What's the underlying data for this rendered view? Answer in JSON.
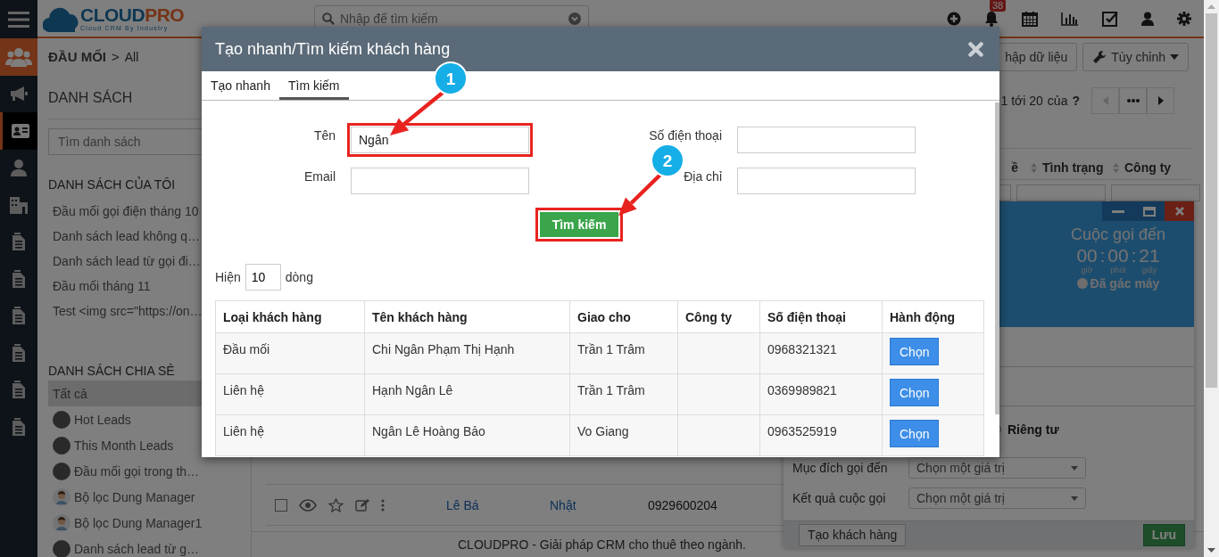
{
  "top_bar": {
    "logo": {
      "part_1": "CLOUD",
      "part_2": "PRO",
      "tagline": "Cloud CRM By Industry"
    },
    "search": {
      "placeholder": "Nhập để tìm kiếm"
    },
    "notifications": {
      "count": "38"
    }
  },
  "rail": [
    {
      "kind": "menu",
      "selected": false
    },
    {
      "kind": "people",
      "selected": false
    },
    {
      "kind": "megaphone",
      "selected": false
    },
    {
      "kind": "card",
      "selected": true
    },
    {
      "kind": "person",
      "selected": false
    },
    {
      "kind": "building",
      "selected": false
    },
    {
      "kind": "document",
      "selected": false
    },
    {
      "kind": "document",
      "selected": false
    },
    {
      "kind": "document",
      "selected": false
    },
    {
      "kind": "document",
      "selected": false
    },
    {
      "kind": "document",
      "selected": false
    },
    {
      "kind": "document",
      "selected": false
    }
  ],
  "breadcrumb": {
    "module": "ĐẦU MỐI",
    "separator": ">",
    "current": "All"
  },
  "sidebar": {
    "title": "DANH SÁCH",
    "search": {
      "placeholder": "Tìm danh sách"
    },
    "groups": [
      {
        "title": "DANH SÁCH CỦA TÔI",
        "items": [
          {
            "label": "Đầu mối gọi điện tháng 10",
            "selected": false,
            "kind": "plain"
          },
          {
            "label": "Danh sách lead không q…",
            "selected": false,
            "kind": "plain"
          },
          {
            "label": "Danh sách lead từ gọi đi…",
            "selected": false,
            "kind": "plain"
          },
          {
            "label": "Đầu mối tháng 11",
            "selected": false,
            "kind": "plain"
          },
          {
            "label": "Test <img src=\"https://on…",
            "selected": false,
            "kind": "plain"
          }
        ]
      },
      {
        "title": "DANH SÁCH CHIA SẺ",
        "items": [
          {
            "label": "Tất cả",
            "selected": true,
            "kind": "plain"
          },
          {
            "label": "Hot Leads",
            "selected": false,
            "kind": "photo"
          },
          {
            "label": "This Month Leads",
            "selected": false,
            "kind": "photo"
          },
          {
            "label": "Đầu mối gọi trong th…",
            "selected": false,
            "kind": "photo"
          },
          {
            "label": "Bộ lọc Dung Manager",
            "selected": false,
            "kind": "cartoon"
          },
          {
            "label": "Bộ lọc Dung Manager1",
            "selected": false,
            "kind": "cartoon"
          },
          {
            "label": "Danh sách lead từ g…",
            "selected": false,
            "kind": "photo"
          }
        ]
      }
    ]
  },
  "toolbar": {
    "buttons": [
      {
        "label": "hập dữ liệu",
        "kind": "plain"
      },
      {
        "label": "Tùy chỉnh",
        "kind": "dropdown"
      }
    ]
  },
  "pagination": {
    "range": "1 tới 20",
    "of": "của",
    "total": "?"
  },
  "list": {
    "columns": [
      "ề",
      "Tình trạng",
      "Công ty"
    ],
    "rows": [
      {
        "checked": false,
        "name": "Lê Bá",
        "assignee": "Nhật",
        "phone": "0929600204"
      }
    ]
  },
  "footer": "CLOUDPRO - Giải pháp CRM cho thuê theo ngành.",
  "call_widget": {
    "title": "Cuộc gọi đến",
    "timer": [
      {
        "value": "00",
        "unit": "giờ"
      },
      {
        "value": "00",
        "unit": "phút"
      },
      {
        "value": "21",
        "unit": "giây"
      }
    ],
    "separators": [
      ":",
      ":"
    ],
    "status": "Đã gác máy",
    "privacy": {
      "label": "Riêng tư",
      "selected": false
    },
    "fields": [
      {
        "label": "Mục đích gọi đến",
        "placeholder": "Chọn một giá trị"
      },
      {
        "label": "Kết quả cuộc gọi",
        "placeholder": "Chọn một giá trị"
      }
    ],
    "buttons": [
      {
        "label": "Tạo khách hàng",
        "kind": "default"
      },
      {
        "label": "Lưu",
        "kind": "primary"
      }
    ]
  },
  "modal": {
    "title": "Tạo nhanh/Tìm kiếm khách hàng",
    "tabs": [
      {
        "label": "Tạo nhanh",
        "selected": false
      },
      {
        "label": "Tìm kiếm",
        "selected": true
      }
    ],
    "fields": [
      {
        "label": "Tên",
        "value": "Ngân",
        "highlighted": true
      },
      {
        "label": "Số điện thoại",
        "highlighted": false
      },
      {
        "label": "Email",
        "highlighted": false
      },
      {
        "label": "Địa chỉ",
        "highlighted": false
      }
    ],
    "search_button": {
      "label": "Tìm kiếm",
      "highlighted": true
    },
    "page_size": {
      "prefix": "Hiện",
      "value": "10",
      "suffix": "dòng"
    },
    "results": {
      "columns": [
        "Loại khách hàng",
        "Tên khách hàng",
        "Giao cho",
        "Công ty",
        "Số điện thoại",
        "Hành động"
      ],
      "rows": [
        {
          "type": "Đầu mối",
          "name": "Chi Ngân Phạm Thị Hạnh",
          "assignee": "Trần 1 Trâm",
          "phone": "0968321321",
          "action": "Chọn"
        },
        {
          "type": "Liên hệ",
          "name": "Hạnh Ngân Lê",
          "assignee": "Trần 1 Trâm",
          "phone": "0369989821",
          "action": "Chọn"
        },
        {
          "type": "Liên hệ",
          "name": "Ngân Lê Hoàng Bảo",
          "assignee": "Vo Giang",
          "phone": "0963525919",
          "action": "Chọn"
        }
      ]
    }
  },
  "annotations": [
    {
      "number": "1"
    },
    {
      "number": "2"
    }
  ]
}
